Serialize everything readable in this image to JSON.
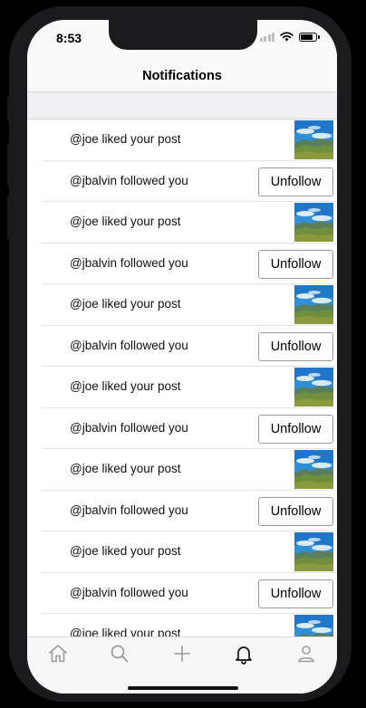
{
  "status_bar": {
    "time": "8:53"
  },
  "header": {
    "title": "Notifications"
  },
  "notifications": [
    {
      "type": "like",
      "text": "@joe liked your post"
    },
    {
      "type": "follow",
      "text": "@jbalvin followed you",
      "button": "Unfollow"
    },
    {
      "type": "like",
      "text": "@joe liked your post"
    },
    {
      "type": "follow",
      "text": "@jbalvin followed you",
      "button": "Unfollow"
    },
    {
      "type": "like",
      "text": "@joe liked your post"
    },
    {
      "type": "follow",
      "text": "@jbalvin followed you",
      "button": "Unfollow"
    },
    {
      "type": "like",
      "text": "@joe liked your post"
    },
    {
      "type": "follow",
      "text": "@jbalvin followed you",
      "button": "Unfollow"
    },
    {
      "type": "like",
      "text": "@joe liked your post"
    },
    {
      "type": "follow",
      "text": "@jbalvin followed you",
      "button": "Unfollow"
    },
    {
      "type": "like",
      "text": "@joe liked your post"
    },
    {
      "type": "follow",
      "text": "@jbalvin followed you",
      "button": "Unfollow"
    },
    {
      "type": "like",
      "text": "@joe liked your post"
    }
  ],
  "tab_bar": {
    "tabs": [
      {
        "icon": "home-icon"
      },
      {
        "icon": "search-icon"
      },
      {
        "icon": "plus-icon"
      },
      {
        "icon": "bell-icon",
        "active": true
      },
      {
        "icon": "profile-icon"
      }
    ]
  },
  "colors": {
    "nav_background": "#f9f9f9",
    "section_gap": "#efeff4",
    "active_tab": "#111111",
    "inactive_tab": "#9a9a9a"
  }
}
